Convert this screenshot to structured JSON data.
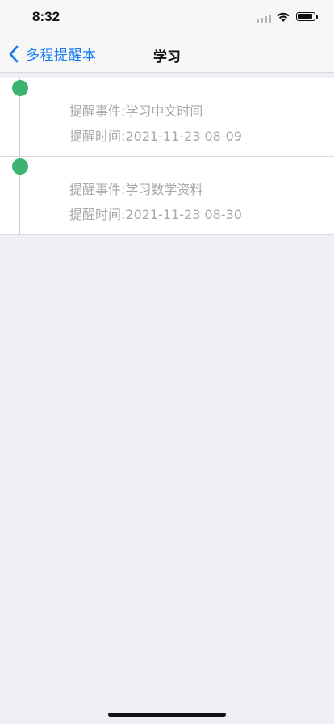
{
  "status_bar": {
    "time": "8:32",
    "signal_icon": "cellular-signal-icon",
    "wifi_icon": "wifi-icon",
    "battery_icon": "battery-icon"
  },
  "nav": {
    "back_label": "多程提醒本",
    "back_icon": "chevron-left-icon",
    "title": "学习",
    "accent_color": "#1a7cf0"
  },
  "reminders": [
    {
      "event": "提醒事件:学习中文时间",
      "time": "提醒时间:2021-11-23 08-09"
    },
    {
      "event": "提醒事件:学习数学资料",
      "time": "提醒时间:2021-11-23 08-30"
    }
  ],
  "colors": {
    "timeline_dot": "#3cb371",
    "text_secondary": "#a8a8ac",
    "background": "#f0eff5"
  }
}
